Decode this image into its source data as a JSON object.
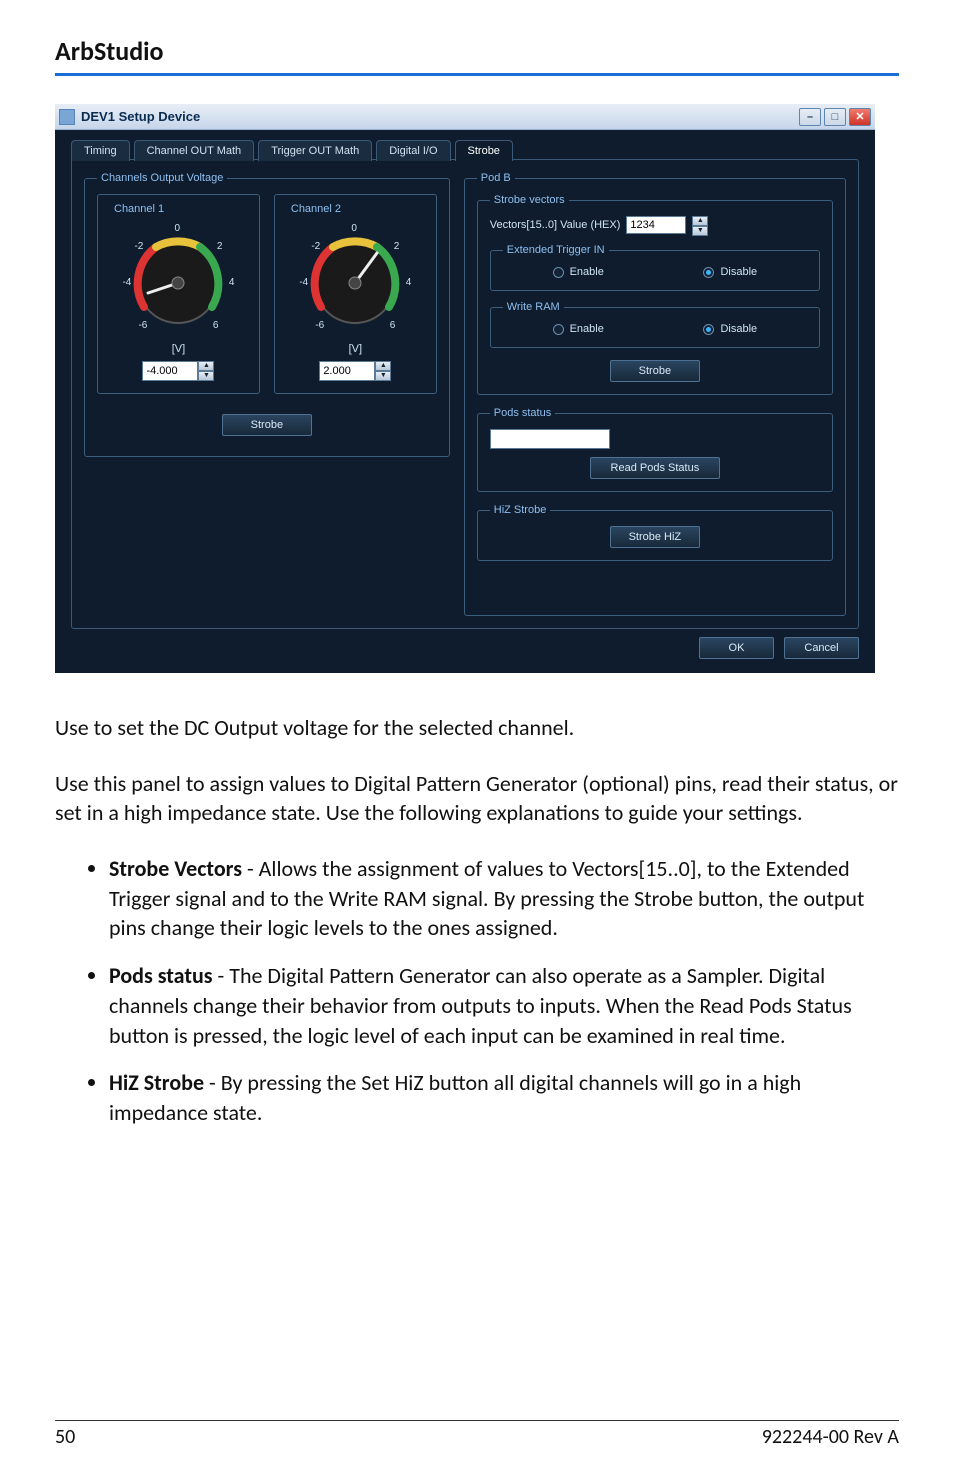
{
  "page": {
    "header": "ArbStudio",
    "footer_left": "50",
    "footer_right": "922244-00 Rev A"
  },
  "dialog": {
    "title": "DEV1 Setup Device",
    "tabs": [
      "Timing",
      "Channel OUT Math",
      "Trigger OUT Math",
      "Digital I/O",
      "Strobe"
    ],
    "active_tab": 4,
    "channels_output_voltage_legend": "Channels Output Voltage",
    "channel1": {
      "legend": "Channel 1",
      "unit": "[V]",
      "value": "-4.000",
      "dial_ticks": [
        "-6",
        "-4",
        "-2",
        "0",
        "2",
        "4",
        "6"
      ]
    },
    "channel2": {
      "legend": "Channel 2",
      "unit": "[V]",
      "value": "2.000",
      "dial_ticks": [
        "-6",
        "-4",
        "-2",
        "0",
        "2",
        "4",
        "6"
      ]
    },
    "left_strobe_btn": "Strobe",
    "podb": {
      "legend": "Pod B",
      "strobe_vectors": {
        "legend": "Strobe vectors",
        "vectors_label": "Vectors[15..0] Value (HEX)",
        "vectors_value": "1234",
        "ext_trigger_legend": "Extended Trigger IN",
        "write_ram_legend": "Write RAM",
        "enable_label": "Enable",
        "disable_label": "Disable",
        "strobe_btn": "Strobe"
      },
      "pods_status": {
        "legend": "Pods status",
        "read_btn": "Read Pods Status"
      },
      "hiz_strobe": {
        "legend": "HiZ Strobe",
        "btn": "Strobe HiZ"
      }
    },
    "ok_btn": "OK",
    "cancel_btn": "Cancel"
  },
  "text": {
    "p1": "Use to set the DC Output voltage for the selected channel.",
    "p2": "Use this panel to assign values to Digital Pattern Generator (optional) pins, read their status, or set in a high impedance state. Use the following explanations to guide your settings.",
    "b1_lead": "Strobe Vectors",
    "b1_rest": " - Allows the assignment of values to Vectors[15..0], to the Extended Trigger signal and to the Write RAM signal. By pressing the Strobe button, the output pins change their logic levels to the ones assigned.",
    "b2_lead": "Pods status",
    "b2_rest": " - The Digital Pattern Generator can also operate as a Sampler. Digital channels change their behavior from outputs to inputs. When the Read Pods Status button is pressed, the logic level of each input can be examined in real time.",
    "b3_lead": "HiZ Strobe",
    "b3_rest": " - By pressing the Set HiZ button all digital channels will go in a high impedance state."
  }
}
